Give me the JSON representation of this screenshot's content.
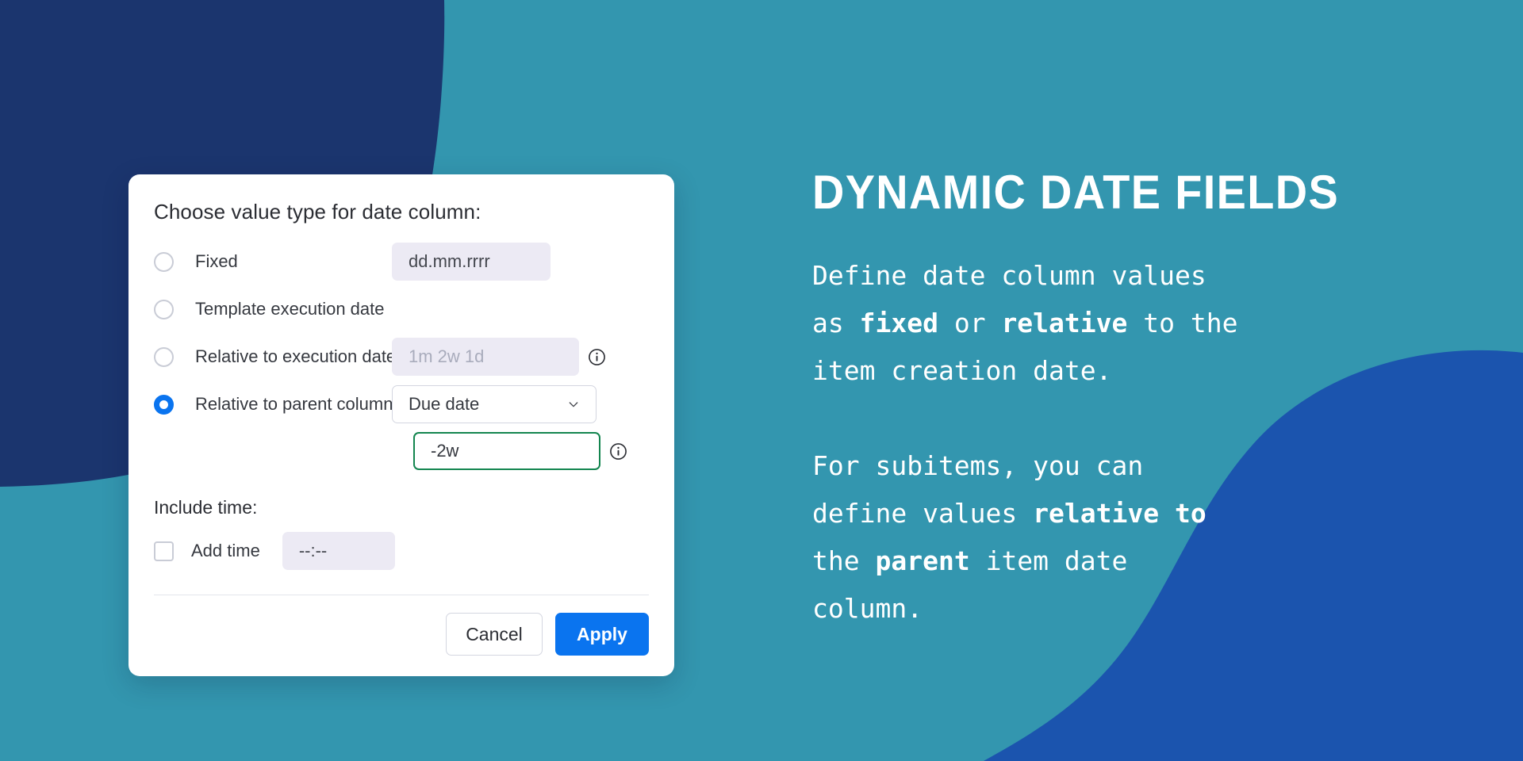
{
  "colors": {
    "background_teal": "#3396af",
    "blob_navy": "#1b356e",
    "blob_blue": "#1b54ae",
    "accent_blue": "#0a74ef",
    "accent_green": "#13854f",
    "field_muted": "#eceaf4"
  },
  "dialog": {
    "title": "Choose value type for date column:",
    "options": [
      {
        "label": "Fixed",
        "selected": false,
        "field_value": "dd.mm.rrrr",
        "field_kind": "muted",
        "has_info": false
      },
      {
        "label": "Template execution date",
        "selected": false,
        "field_value": "",
        "field_kind": "none",
        "has_info": false
      },
      {
        "label": "Relative to execution date",
        "selected": false,
        "field_value": "1m 2w 1d",
        "field_kind": "muted-placeholder",
        "has_info": true,
        "info_icon": "info-circle-icon"
      },
      {
        "label": "Relative to parent column",
        "selected": true,
        "field_value": "Due date",
        "field_kind": "select",
        "has_info": false,
        "chevron_icon": "chevron-down-icon"
      }
    ],
    "relative_value": {
      "value": "-2w",
      "has_info": true,
      "info_icon": "info-circle-icon"
    },
    "include_time": {
      "section_label": "Include time:",
      "checkbox_label": "Add time",
      "checked": false,
      "time_value": "--:--"
    },
    "buttons": {
      "cancel": "Cancel",
      "apply": "Apply"
    }
  },
  "panel": {
    "heading": "DYNAMIC DATE FIELDS",
    "paragraph_1": {
      "line_1_a": "Define date column values",
      "line_2_a": "as ",
      "line_2_b": "fixed",
      "line_2_c": " or ",
      "line_2_d": "relative",
      "line_2_e": " to the",
      "line_3_a": "item creation date."
    },
    "paragraph_2": {
      "line_1_a": "For subitems, you can",
      "line_2_a": "define values ",
      "line_2_b": "relative to",
      "line_3_a": "the ",
      "line_3_b": "parent",
      "line_3_c": " item date",
      "line_4_a": "column."
    }
  }
}
